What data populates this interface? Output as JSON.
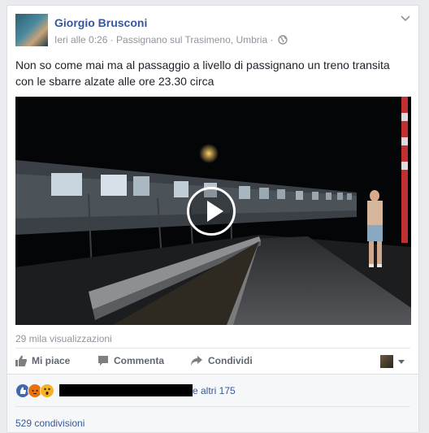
{
  "post": {
    "author": "Giorgio Brusconi",
    "meta": "Ieri alle 0:26 · Passignano sul Trasimeno, Umbria ·",
    "text": "Non so come mai ma al passaggio a livello di passignano un treno transita con le sbarre alzate alle ore 23.30 circa"
  },
  "video": {
    "views": "29 mila visualizzazioni"
  },
  "actions": {
    "like_label": "Mi piace",
    "comment_label": "Commenta",
    "share_label": "Condividi"
  },
  "feedback": {
    "others": "e altri 175",
    "shares": "529 condivisioni"
  },
  "colors": {
    "link": "#365899",
    "accent": "#4267b2"
  },
  "icons": [
    "globe-icon",
    "chevron-down-icon",
    "play-icon",
    "like-icon",
    "comment-icon",
    "share-icon",
    "like-reaction-icon",
    "angry-reaction-icon",
    "wow-reaction-icon"
  ]
}
